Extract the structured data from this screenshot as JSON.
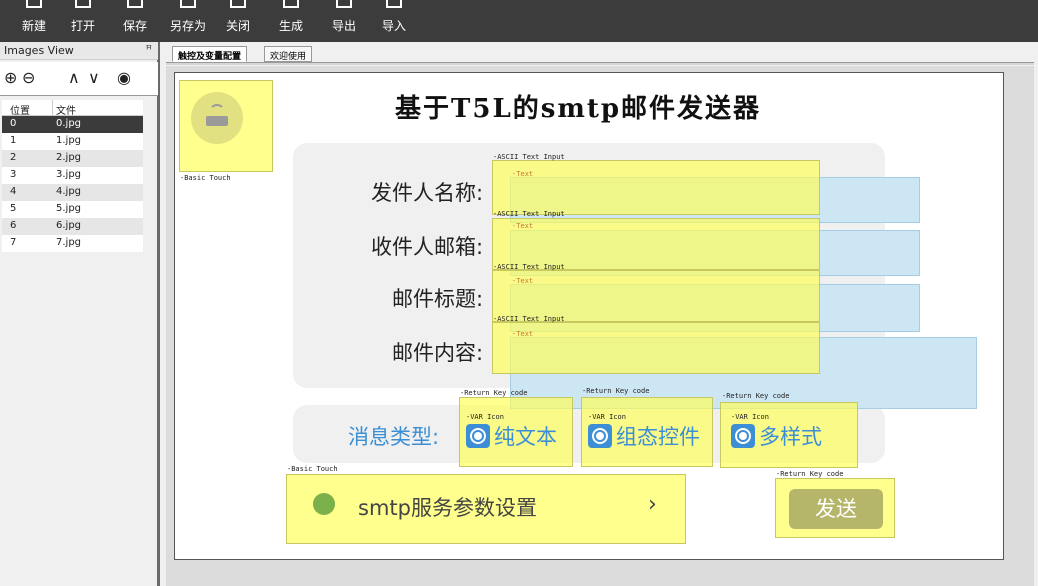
{
  "toolbar": {
    "buttons": [
      {
        "label": "新建",
        "icon": "new-file-icon"
      },
      {
        "label": "打开",
        "icon": "open-folder-icon"
      },
      {
        "label": "保存",
        "icon": "save-icon"
      },
      {
        "label": "另存为",
        "icon": "save-as-icon"
      },
      {
        "label": "关闭",
        "icon": "close-file-icon"
      },
      {
        "label": "生成",
        "icon": "build-icon"
      },
      {
        "label": "导出",
        "icon": "export-icon"
      },
      {
        "label": "导入",
        "icon": "import-icon"
      }
    ]
  },
  "images_view": {
    "title": "Images View",
    "pin": "ꟸ",
    "columns": {
      "position": "位置",
      "file": "文件"
    },
    "rows": [
      {
        "position": "0",
        "file": "0.jpg"
      },
      {
        "position": "1",
        "file": "1.jpg"
      },
      {
        "position": "2",
        "file": "2.jpg"
      },
      {
        "position": "3",
        "file": "3.jpg"
      },
      {
        "position": "4",
        "file": "4.jpg"
      },
      {
        "position": "5",
        "file": "5.jpg"
      },
      {
        "position": "6",
        "file": "6.jpg"
      },
      {
        "position": "7",
        "file": "7.jpg"
      }
    ],
    "selected_index": 0
  },
  "tabs": [
    {
      "label": "触控及变量配置",
      "active": true
    },
    {
      "label": "欢迎使用",
      "active": false
    }
  ],
  "canvas": {
    "title": "基于T5L的smtp邮件发送器",
    "fields": [
      {
        "label": "发件人名称:",
        "widget": "-ASCII Text Input",
        "text_tag": "-Text"
      },
      {
        "label": "收件人邮箱:",
        "widget": "-ASCII Text Input",
        "text_tag": "-Text"
      },
      {
        "label": "邮件标题:",
        "widget": "-ASCII Text Input",
        "text_tag": "-Text"
      },
      {
        "label": "邮件内容:",
        "widget": "-ASCII Text Input",
        "text_tag": "-Text"
      }
    ],
    "basic_touch_label": "-Basic Touch",
    "message_type_label": "消息类型:",
    "return_key_label": "-Return Key code",
    "var_icon_label": "-VAR Icon",
    "message_options": [
      "纯文本",
      "组态控件",
      "多样式"
    ],
    "smtp_settings_label": "smtp服务参数设置",
    "chevron": "›",
    "send_label": "发送"
  },
  "colors": {
    "accent_blue": "#3c8fd4",
    "highlight_yellow": "#ffff50",
    "toolbar_bg": "#3c3c3c"
  }
}
